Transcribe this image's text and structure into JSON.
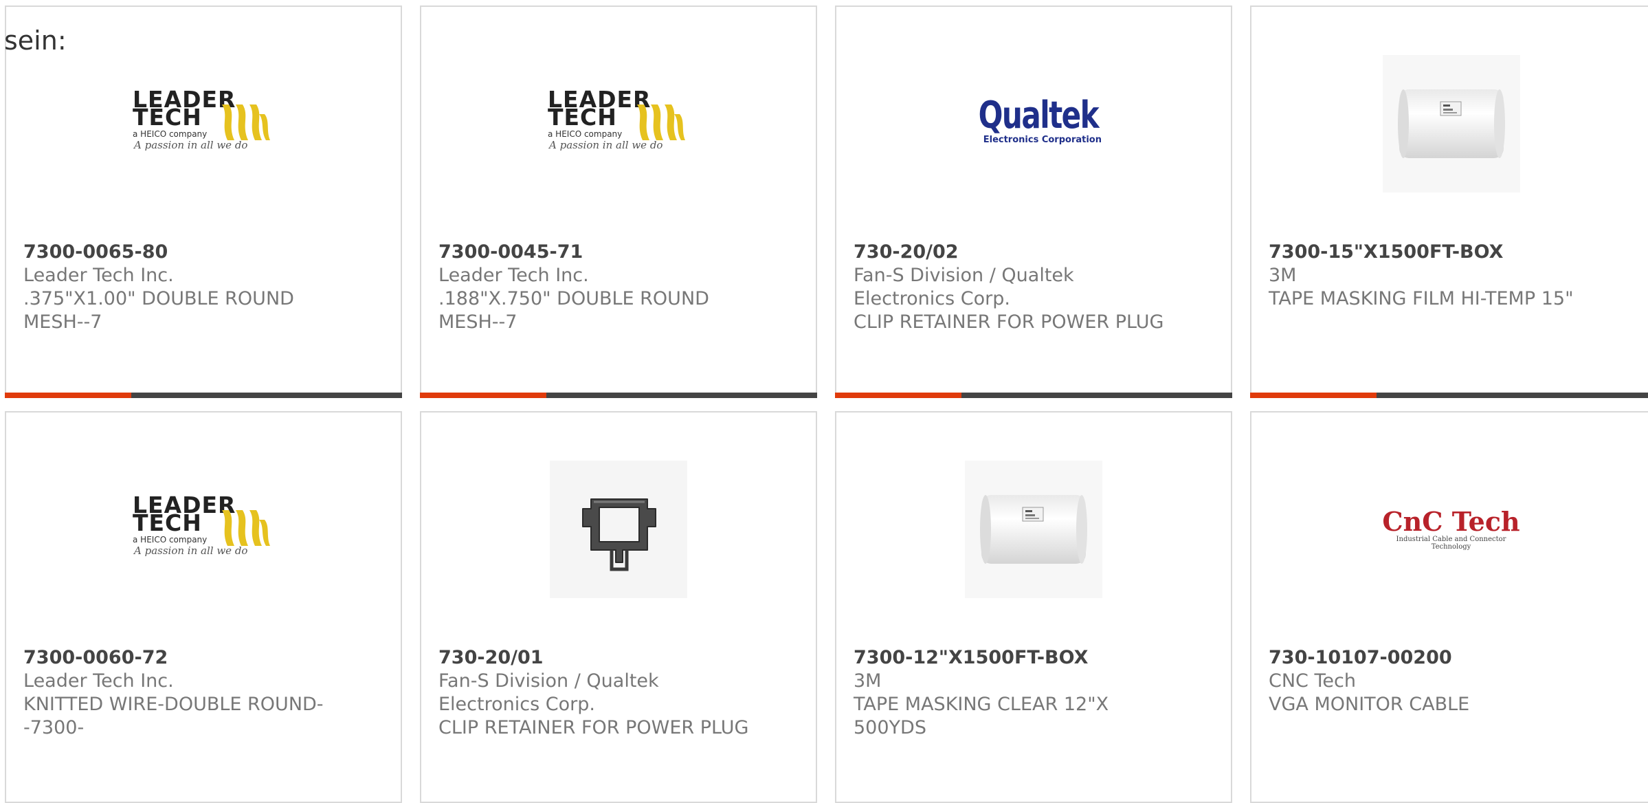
{
  "intro_text": "sein:",
  "colors": {
    "accent": "#e03b0c",
    "bar": "#444444",
    "card_border": "#d9d9d9",
    "part_number": "#444444",
    "text_muted": "#777777"
  },
  "logos": {
    "leader_tech": {
      "line1": "LEADER",
      "line2": "TECH",
      "company": "a HEICO company",
      "tagline": "A passion in all we do"
    },
    "qualtek": {
      "name": "Qualtek",
      "sub": "Electronics Corporation"
    },
    "cnc_tech": {
      "name": "CnC Tech",
      "sub": "Industrial Cable and Connector Technology"
    }
  },
  "products": [
    {
      "part_number": "7300-0065-80",
      "manufacturer": "Leader Tech Inc.",
      "description": ".375\"X1.00\" DOUBLE ROUND MESH--7",
      "image": "leader-tech-logo"
    },
    {
      "part_number": "7300-0045-71",
      "manufacturer": "Leader Tech Inc.",
      "description": ".188\"X.750\" DOUBLE ROUND MESH--7",
      "image": "leader-tech-logo"
    },
    {
      "part_number": "730-20/02",
      "manufacturer": "Fan-S Division / Qualtek Electronics Corp.",
      "description": "CLIP RETAINER FOR POWER PLUG",
      "image": "qualtek-logo"
    },
    {
      "part_number": "7300-15\"X1500FT-BOX",
      "manufacturer": "3M",
      "description": "TAPE MASKING FILM HI-TEMP 15\"",
      "image": "tape-roll-image"
    },
    {
      "part_number": "7300-0060-72",
      "manufacturer": "Leader Tech Inc.",
      "description": "KNITTED WIRE-DOUBLE ROUND--7300-",
      "image": "leader-tech-logo"
    },
    {
      "part_number": "730-20/01",
      "manufacturer": "Fan-S Division / Qualtek Electronics Corp.",
      "description": "CLIP RETAINER FOR POWER PLUG",
      "image": "clip-image"
    },
    {
      "part_number": "7300-12\"X1500FT-BOX",
      "manufacturer": "3M",
      "description": "TAPE MASKING CLEAR 12\"X 500YDS",
      "image": "tape-roll-image"
    },
    {
      "part_number": "730-10107-00200",
      "manufacturer": "CNC Tech",
      "description": "VGA MONITOR CABLE",
      "image": "cnc-tech-logo"
    }
  ]
}
